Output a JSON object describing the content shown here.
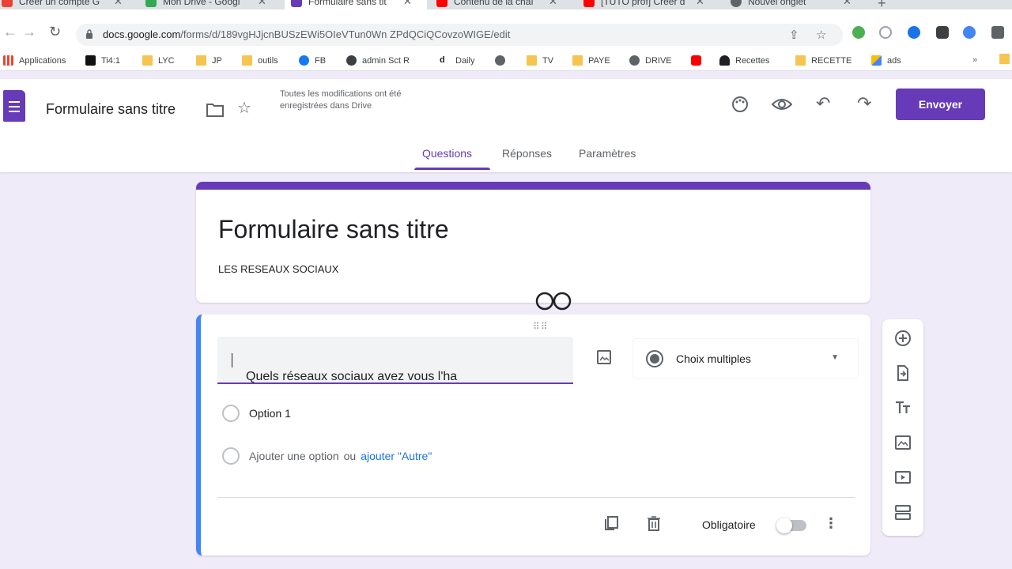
{
  "browser": {
    "tabs": [
      {
        "title": "Créer un compte G",
        "favicon_color": "#ea4335"
      },
      {
        "title": "Mon Drive - Googl",
        "favicon_color": "#34a853"
      },
      {
        "title": "Formulaire sans tit",
        "favicon_color": "#673ab7",
        "active": true
      },
      {
        "title": "Contenu de la chaî",
        "favicon_color": "#ff0000"
      },
      {
        "title": "[TUTO prof] Créer d",
        "favicon_color": "#ff0000"
      },
      {
        "title": "Nouvel onglet",
        "favicon_color": "#5f6368"
      }
    ],
    "url_domain": "docs.google.com",
    "url_path": "/forms/d/189vgHJjcnBUSzEWi5OIeVTun0Wn ZPdQCiQCovzoWIGE/edit",
    "bookmarks": [
      {
        "label": "Applications",
        "icon": "apps-grid"
      },
      {
        "label": "Ti4:1",
        "icon": "black-square"
      },
      {
        "label": "LYC",
        "icon": "folder"
      },
      {
        "label": "JP",
        "icon": "folder"
      },
      {
        "label": "outils",
        "icon": "folder"
      },
      {
        "label": "FB",
        "icon": "facebook"
      },
      {
        "label": "admin Sct R",
        "icon": "wordpress"
      },
      {
        "label": "Daily",
        "icon": "dailymotion"
      },
      {
        "label": "",
        "icon": "globe"
      },
      {
        "label": "TV",
        "icon": "folder"
      },
      {
        "label": "PAYE",
        "icon": "folder"
      },
      {
        "label": "DRIVE",
        "icon": "globe"
      },
      {
        "label": "",
        "icon": "youtube"
      },
      {
        "label": "Recettes",
        "icon": "chef"
      },
      {
        "label": "RECETTE",
        "icon": "folder"
      },
      {
        "label": "ads",
        "icon": "google-ads"
      }
    ]
  },
  "header": {
    "doc_title": "Formulaire sans titre",
    "saved_note": "Toutes les modifications ont été enregistrées dans Drive",
    "send_label": "Envoyer",
    "tabs": [
      {
        "label": "Questions",
        "active": true
      },
      {
        "label": "Réponses"
      },
      {
        "label": "Paramètres"
      }
    ]
  },
  "form": {
    "title": "Formulaire sans titre",
    "description": "LES RESEAUX SOCIAUX"
  },
  "question": {
    "text": "Quels réseaux sociaux avez vous l'ha",
    "type_label": "Choix multiples",
    "option_1": "Option 1",
    "add_option": "Ajouter une option",
    "or_label": "ou",
    "add_other": "ajouter \"Autre\"",
    "required_label": "Obligatoire",
    "required": false
  },
  "colors": {
    "brand": "#673ab7",
    "page_bg": "#f0ebf8",
    "active_card_border": "#4285f4",
    "link": "#1a73e8"
  }
}
